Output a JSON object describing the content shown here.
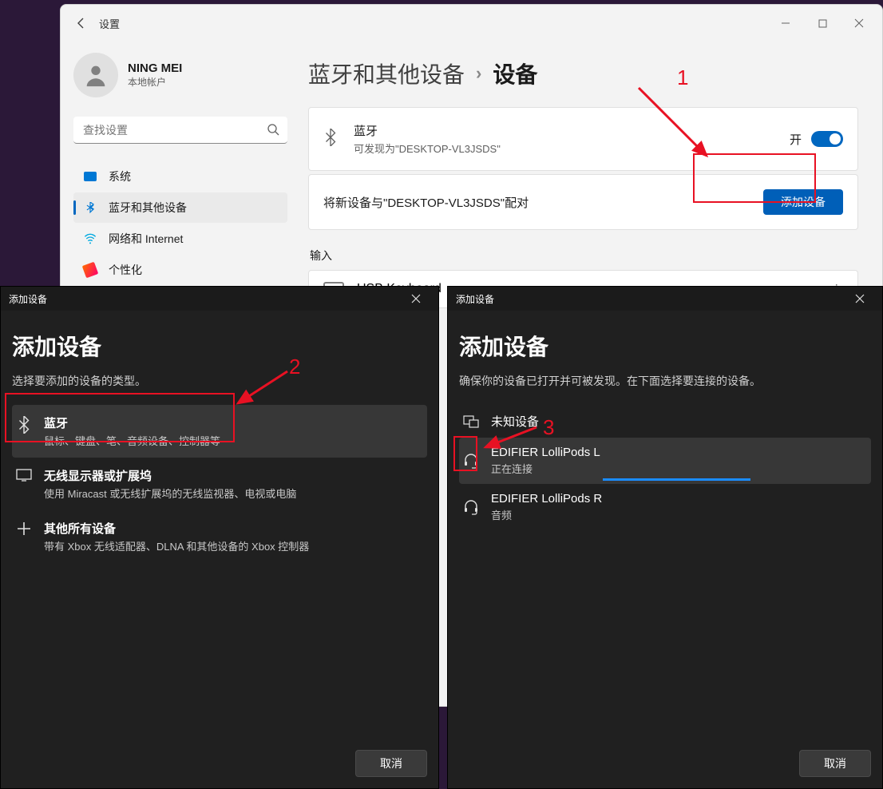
{
  "settings": {
    "title": "设置",
    "user": {
      "name": "NING MEI",
      "sub": "本地帐户"
    },
    "search_placeholder": "查找设置",
    "nav": {
      "system": "系统",
      "bluetooth": "蓝牙和其他设备",
      "network": "网络和 Internet",
      "personalize": "个性化"
    },
    "breadcrumb": {
      "parent": "蓝牙和其他设备",
      "current": "设备"
    },
    "bt_card": {
      "title": "蓝牙",
      "sub": "可发现为\"DESKTOP-VL3JSDS\"",
      "state": "开"
    },
    "pair": {
      "text": "将新设备与\"DESKTOP-VL3JSDS\"配对",
      "btn": "添加设备"
    },
    "input_section": "输入",
    "usb": "USB Keyboard"
  },
  "dlg1": {
    "titlebar": "添加设备",
    "header": "添加设备",
    "sub": "选择要添加的设备的类型。",
    "options": {
      "bt": {
        "t": "蓝牙",
        "s": "鼠标、键盘、笔、音频设备、控制器等"
      },
      "display": {
        "t": "无线显示器或扩展坞",
        "s": "使用 Miracast 或无线扩展坞的无线监视器、电视或电脑"
      },
      "other": {
        "t": "其他所有设备",
        "s": "带有 Xbox 无线适配器、DLNA 和其他设备的 Xbox 控制器"
      }
    },
    "cancel": "取消"
  },
  "dlg2": {
    "titlebar": "添加设备",
    "header": "添加设备",
    "sub": "确保你的设备已打开并可被发现。在下面选择要连接的设备。",
    "unknown": "未知设备",
    "devices": {
      "d1": {
        "t": "EDIFIER LolliPods L",
        "s": "正在连接"
      },
      "d2": {
        "t": "EDIFIER LolliPods R",
        "s": "音频"
      }
    },
    "cancel": "取消"
  },
  "steps": {
    "s1": "1",
    "s2": "2",
    "s3": "3"
  }
}
